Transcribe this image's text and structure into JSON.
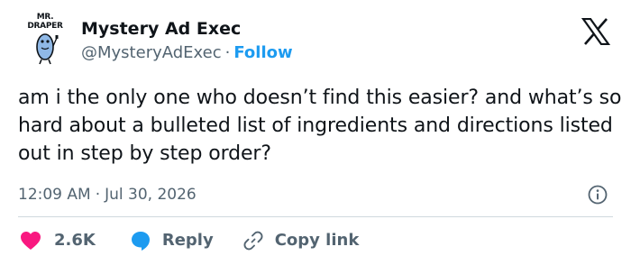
{
  "author": {
    "avatar_brand": "MR. DRAPER",
    "display_name": "Mystery Ad Exec",
    "handle": "@MysteryAdExec",
    "separator": "·",
    "follow_label": "Follow"
  },
  "tweet": {
    "text": "am i the only one who doesn’t find this easier? and what’s so hard about a bulleted list of ingredients and directions listed out in step by step order?",
    "time": "12:09 AM",
    "date": "Jul 30, 2026"
  },
  "actions": {
    "like_count": "2.6K",
    "reply_label": "Reply",
    "copy_link_label": "Copy link"
  },
  "icons": [
    "x-logo-icon",
    "info-icon",
    "heart-icon",
    "reply-bubble-icon",
    "link-icon"
  ],
  "colors": {
    "accent": "#1d9bf0",
    "like": "#f91880",
    "text": "#0f1419",
    "secondary": "#536471",
    "divider": "#cfd9de"
  }
}
